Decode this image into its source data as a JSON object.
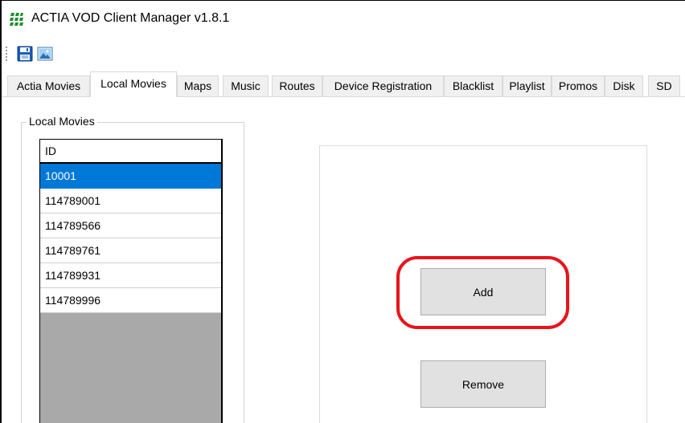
{
  "window": {
    "title": "ACTIA VOD Client Manager v1.8.1"
  },
  "toolbar": {
    "buttons": [
      {
        "name": "save",
        "icon": "floppy-disk-icon"
      },
      {
        "name": "image",
        "icon": "image-icon"
      }
    ]
  },
  "tabs": [
    {
      "label": "Actia Movies",
      "active": false
    },
    {
      "label": "Local Movies",
      "active": true
    },
    {
      "label": "Maps",
      "active": false
    },
    {
      "label": "Music",
      "active": false
    },
    {
      "label": "Routes",
      "active": false
    },
    {
      "label": "Device Registration",
      "active": false
    },
    {
      "label": "Blacklist",
      "active": false
    },
    {
      "label": "Playlist",
      "active": false
    },
    {
      "label": "Promos",
      "active": false
    },
    {
      "label": "Disk",
      "active": false
    },
    {
      "label": "SD",
      "active": false
    }
  ],
  "local_movies": {
    "group_label": "Local Movies",
    "column_header": "ID",
    "rows": [
      "10001",
      "114789001",
      "114789566",
      "114789761",
      "114789931",
      "114789996"
    ],
    "selected_index": 0
  },
  "actions": {
    "add_label": "Add",
    "remove_label": "Remove"
  },
  "colors": {
    "selection": "#0078d7",
    "highlight_ring": "#e8141b",
    "list_empty_area": "#a9a9a9"
  }
}
